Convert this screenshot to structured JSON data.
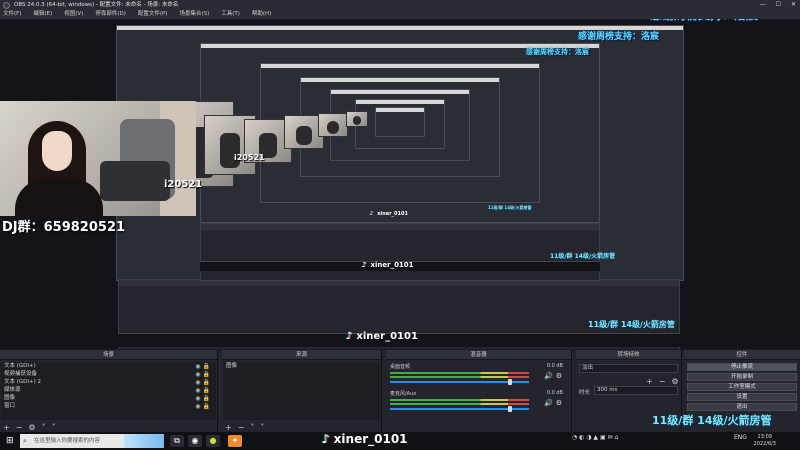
{
  "window": {
    "title": "OBS 24.0.3 (64-bit, windows) - 配置文件: 未命名 - 场景: 未命名",
    "controls": [
      "—",
      "☐",
      "✕"
    ]
  },
  "menu": [
    "文件(F)",
    "编辑(E)",
    "视图(V)",
    "停靠部件(D)",
    "配置文件(P)",
    "场景集合(S)",
    "工具(T)",
    "帮助(H)"
  ],
  "overlays": {
    "thanks": "感谢周榜支持：洛宸",
    "qq_group": "DJ群：659820521",
    "crop_number_a": "i20521",
    "crop_number_b": "i20521",
    "tiktok_handle": "xiner_0101",
    "level_text": "11级/群 14级/火箭房管"
  },
  "docks": {
    "scenes": {
      "title": "场景",
      "items": [
        "文本 (GDI+)",
        "视频捕获设备",
        "文本 (GDI+) 2",
        "媒体源",
        "图像",
        "窗口"
      ]
    },
    "sources": {
      "title": "来源",
      "items": [
        "图像"
      ]
    },
    "mixer": {
      "title": "混音器",
      "channels": [
        {
          "name": "桌面音频",
          "db": "0.0 dB"
        },
        {
          "name": "麦克风/Aux",
          "db": "0.0 dB"
        }
      ]
    },
    "transitions": {
      "title": "转场特效",
      "type": "淡出",
      "duration_label": "时长",
      "duration": "300 ms"
    },
    "controls": {
      "title": "控件",
      "buttons": [
        "停止推流",
        "开始录制",
        "工作室模式",
        "设置",
        "退出"
      ]
    }
  },
  "taskbar": {
    "search_placeholder": "在这里输入你要搜索的内容",
    "tray_lang": "ENG",
    "time": "23:09",
    "date": "2022/6/3"
  },
  "colors": {
    "accent_cyan": "#5fd8ff",
    "meter_green": "#4ba84b",
    "fader_blue": "#2a8fe0",
    "bg_dark": "#1b1c21"
  }
}
